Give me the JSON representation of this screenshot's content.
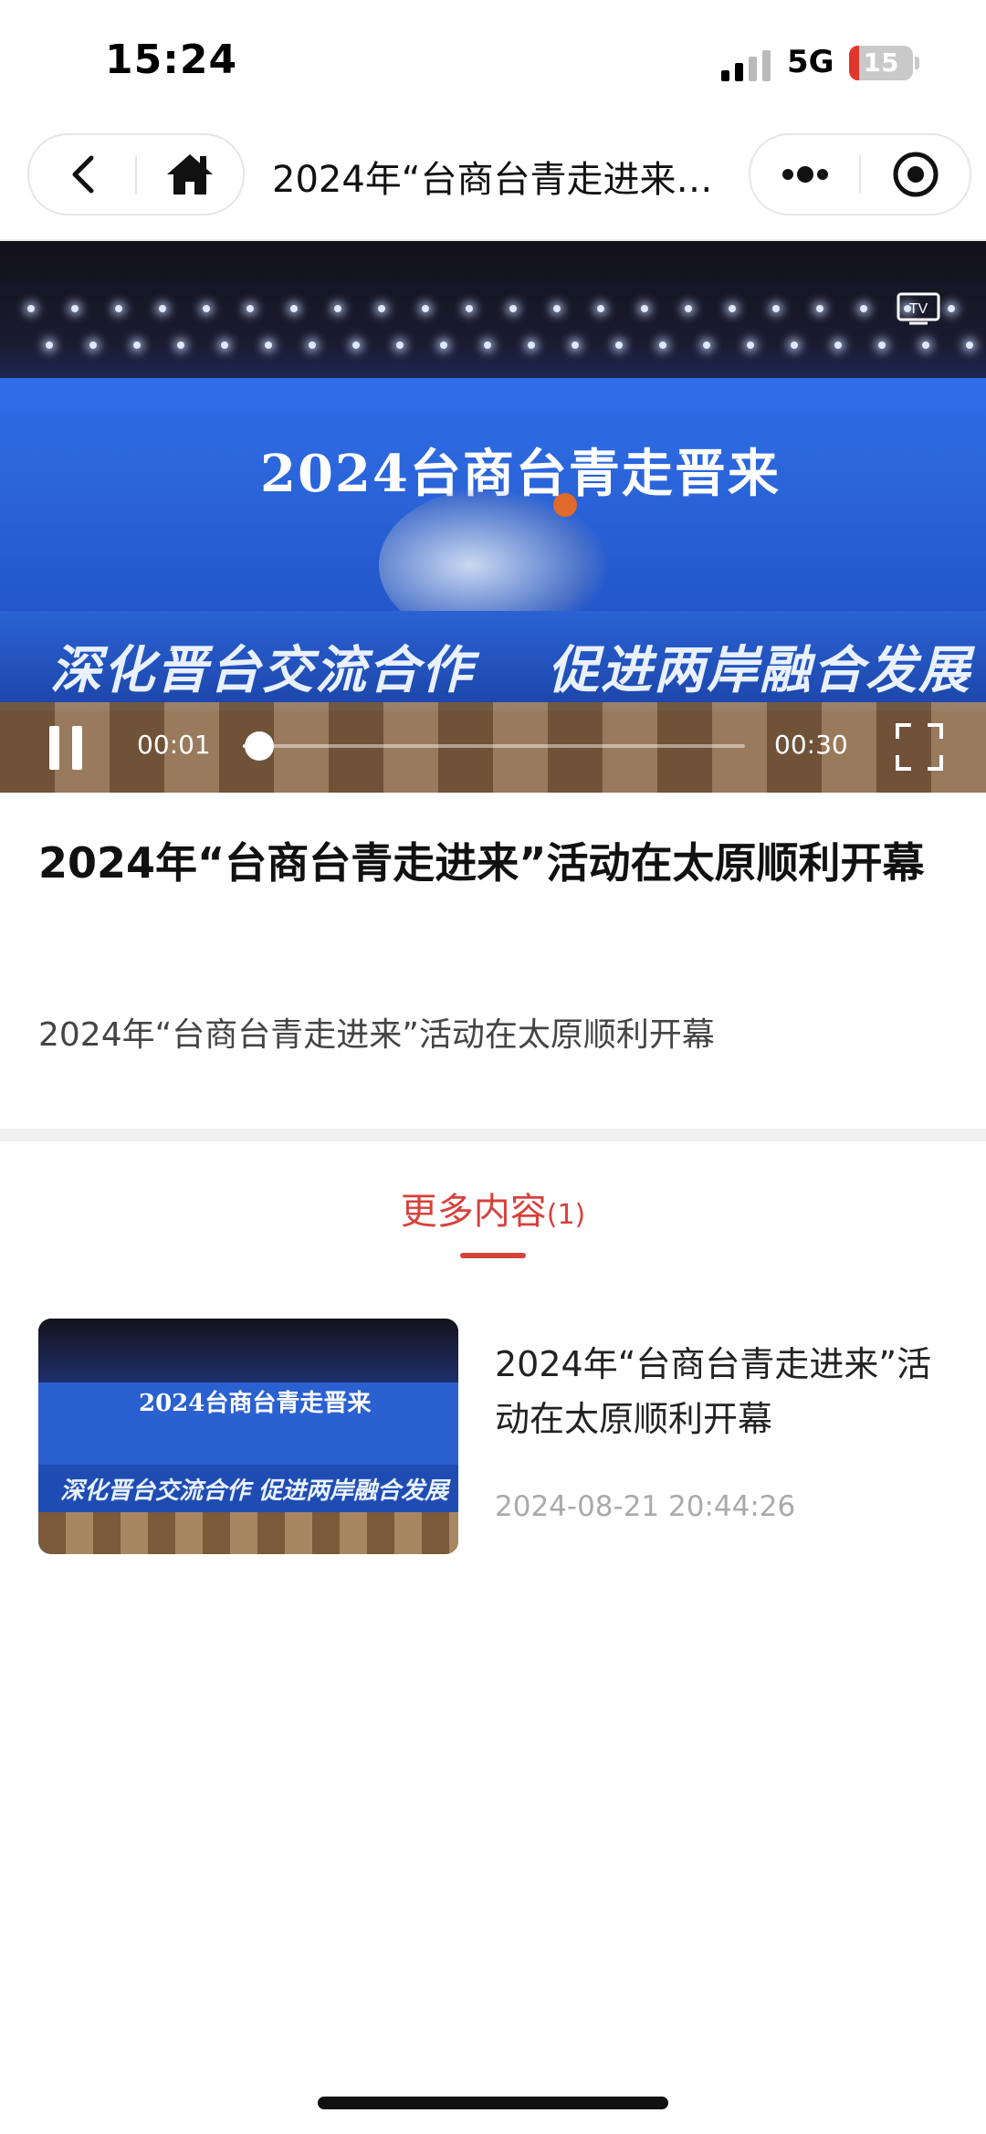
{
  "status_bar": {
    "time": "15:24",
    "network": "5G",
    "battery": "15",
    "battery_level": 0.15
  },
  "nav": {
    "title": "2024年“台商台青走进来…",
    "icons": [
      "chevron-left-icon",
      "home-icon",
      "more-dots-icon",
      "target-icon"
    ]
  },
  "video": {
    "screen_title": "2024台商台青走晋来",
    "banner_left": "深化晋台交流合作",
    "banner_right": "促进两岸融合发展",
    "current_time": "00:01",
    "total_time": "00:30",
    "progress": 0.033,
    "tv_label": "TV"
  },
  "article": {
    "title": "2024年“台商台青走进来”活动在太原顺利开幕",
    "description": "2024年“台商台青走进来”活动在太原顺利开幕"
  },
  "more": {
    "heading": "更多内容",
    "count": "(1)",
    "items": [
      {
        "thumb_title": "2024台商台青走晋来",
        "thumb_banner": "深化晋台交流合作  促进两岸融合发展",
        "title": "2024年“台商台青走进来”活动在太原顺利开幕",
        "time": "2024-08-21 20:44:26"
      }
    ]
  },
  "colors": {
    "accent": "#d6423c",
    "battery_low": "#e0362b"
  }
}
